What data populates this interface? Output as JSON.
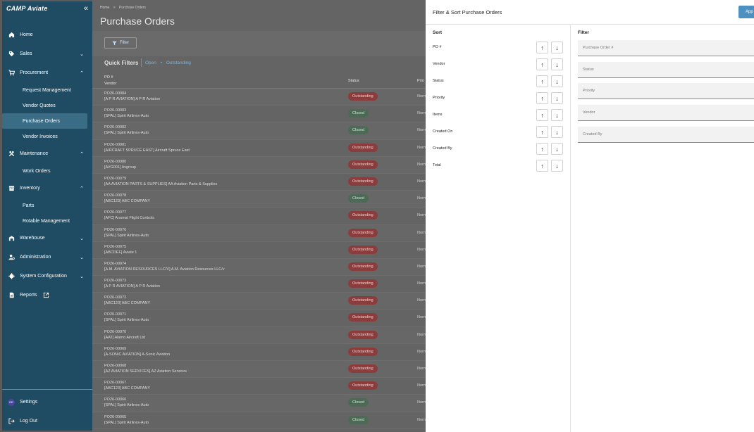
{
  "sidebar": {
    "logo": "CAMP Aviate",
    "collapse_glyph": "«",
    "items": [
      {
        "label": "Home",
        "icon": "home-icon",
        "chev": ""
      },
      {
        "label": "Sales",
        "icon": "tag-icon",
        "chev": "⌄"
      },
      {
        "label": "Procurement",
        "icon": "cart-icon",
        "chev": "⌃"
      }
    ],
    "procurement_sub": [
      "Request Management",
      "Vendor Quotes",
      "Purchase Orders",
      "Vendor Invoices"
    ],
    "maintenance": {
      "label": "Maintenance",
      "chev": "⌃"
    },
    "maintenance_sub": [
      "Work Orders"
    ],
    "inventory": {
      "label": "Inventory",
      "chev": "⌃"
    },
    "inventory_sub": [
      "Parts",
      "Rotable Management"
    ],
    "warehouse": {
      "label": "Warehouse",
      "chev": "⌄"
    },
    "administration": {
      "label": "Administration",
      "chev": "⌄"
    },
    "system_config": {
      "label": "System Configuration",
      "chev": "⌄"
    },
    "reports": {
      "label": "Reports"
    },
    "settings": {
      "label": "Settings",
      "badge": "DE"
    },
    "logout": {
      "label": "Log Out"
    }
  },
  "main": {
    "breadcrumb_home": "Home",
    "breadcrumb_sep": ">",
    "breadcrumb_current": "Purchase Orders",
    "title": "Purchase Orders",
    "filter_button": "Filter",
    "quick_filters_label": "Quick Filters",
    "quick_filter_open": "Open",
    "quick_filter_bullet": "•",
    "quick_filter_outstanding": "Outstanding",
    "columns": {
      "po": "PO #",
      "vendor": "Vendor",
      "status": "Status",
      "priority": "Prio"
    },
    "rows": [
      {
        "po": "PO26-00084",
        "vendor": "[A P R AVIATION] A P R Aviation",
        "status": "Outstanding",
        "priority": "Norm"
      },
      {
        "po": "PO26-00083",
        "vendor": "[SPAL] Spirit Airlines-Auto",
        "status": "Closed",
        "priority": "Norm"
      },
      {
        "po": "PO26-00082",
        "vendor": "[SPAL] Spirit Airlines-Auto",
        "status": "Closed",
        "priority": "Norm"
      },
      {
        "po": "PO26-00081",
        "vendor": "[AIRCRAFT SPRUCE EAST] Aircraft Spruce East",
        "status": "Outstanding",
        "priority": "Norm"
      },
      {
        "po": "PO26-00080",
        "vendor": "[AVG001] Avgroup",
        "status": "Outstanding",
        "priority": "Norm"
      },
      {
        "po": "PO26-00079",
        "vendor": "[AA AVIATION PARTS & SUPPLIES] AA Aviation Parts & Supplies",
        "status": "Outstanding",
        "priority": "Norm"
      },
      {
        "po": "PO26-00078",
        "vendor": "[ABC123] ABC COMPANY",
        "status": "Closed",
        "priority": "Norm"
      },
      {
        "po": "PO26-00077",
        "vendor": "[AFC] Arsenal Flight Controls",
        "status": "Outstanding",
        "priority": "Norm"
      },
      {
        "po": "PO26-00076",
        "vendor": "[SPAL] Spirit Airlines-Auto",
        "status": "Outstanding",
        "priority": "Norm"
      },
      {
        "po": "PO26-00075",
        "vendor": "[ABCDEF] Aviate 1",
        "status": "Outstanding",
        "priority": "Norm"
      },
      {
        "po": "PO26-00074",
        "vendor": "[A.M. AVIATION RESOURCES LLC/V] A.M. Aviation Resources LLC/v",
        "status": "Outstanding",
        "priority": "Norm"
      },
      {
        "po": "PO26-00073",
        "vendor": "[A P R AVIATION] A P R Aviation",
        "status": "Outstanding",
        "priority": "Norm"
      },
      {
        "po": "PO26-00072",
        "vendor": "[ABC123] ABC COMPANY",
        "status": "Outstanding",
        "priority": "Norm"
      },
      {
        "po": "PO26-00071",
        "vendor": "[SPAL] Spirit Airlines-Auto",
        "status": "Outstanding",
        "priority": "Norm"
      },
      {
        "po": "PO26-00070",
        "vendor": "[AAT] Alamo Aircraft Ltd",
        "status": "Outstanding",
        "priority": "Norm"
      },
      {
        "po": "PO26-00069",
        "vendor": "[A-SONIC AVIATION] A-Sonic Aviation",
        "status": "Outstanding",
        "priority": "Norm"
      },
      {
        "po": "PO26-00068",
        "vendor": "[AZ AVIATION SERVICES] AZ Aviation Services",
        "status": "Outstanding",
        "priority": "Norm"
      },
      {
        "po": "PO26-00067",
        "vendor": "[ABC123] ABC COMPANY",
        "status": "Outstanding",
        "priority": "Norm"
      },
      {
        "po": "PO26-00066",
        "vendor": "[SPAL] Spirit Airlines-Auto",
        "status": "Closed",
        "priority": "Norm"
      },
      {
        "po": "PO26-00065",
        "vendor": "[SPAL] Spirit Airlines-Auto",
        "status": "Closed",
        "priority": "Norm"
      }
    ]
  },
  "drawer": {
    "title": "Filter & Sort Purchase Orders",
    "apply_button": "App",
    "sort_heading": "Sort",
    "filter_heading": "Filter",
    "sort_fields": [
      "PO #",
      "Vendor",
      "Status",
      "Priority",
      "Items",
      "Created On",
      "Created By",
      "Total"
    ],
    "filter_fields": [
      "Purchase Order #",
      "Status",
      "Priority",
      "Vendor",
      "Created By"
    ]
  },
  "colors": {
    "sidebar": "#1f4b63",
    "sidebar_active": "#3a6c86",
    "apply": "#4c91c0",
    "outstanding": "#8b3d3d",
    "closed": "#4d6a56"
  }
}
